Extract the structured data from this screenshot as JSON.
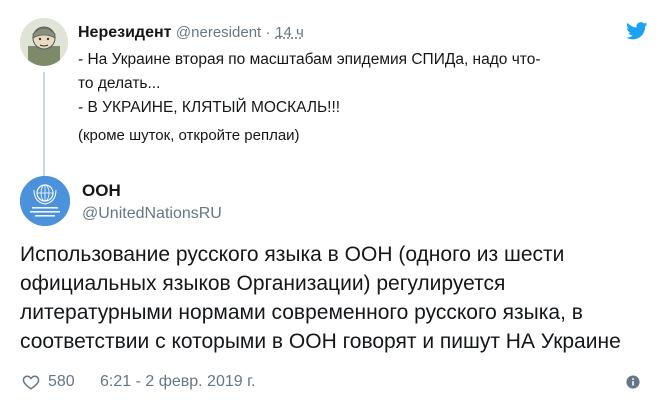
{
  "parent_tweet": {
    "name": "Нерезидент",
    "handle": "@neresident",
    "separator": "·",
    "time": "14 ч",
    "lines": [
      "- На Украине вторая по масштабам эпидемия СПИДа, надо что-",
      "то делать...",
      "- В УКРАИНЕ, КЛЯТЫЙ МОСКАЛЬ!!!",
      "(кроме шуток, откройте реплаи)"
    ]
  },
  "main_tweet": {
    "name": "ООН",
    "handle": "@UnitedNationsRU",
    "avatar_label": "Организация Объединённых Наций",
    "lines": [
      "Использование русского языка в ООН (одного из шести",
      "официальных языков Организации) регулируется",
      "литературными нормами современного русского языка, в",
      "соответствии с которыми в ООН говорят и пишут НА Украине"
    ],
    "likes": "580",
    "timestamp": "6:21 - 2 февр. 2019 г."
  },
  "icons": {
    "platform": "twitter-bird-icon",
    "like": "heart-icon",
    "info": "info-icon"
  },
  "colors": {
    "brand": "#1da1f2",
    "text": "#14171a",
    "muted": "#657786",
    "un_blue": "#4b92db"
  }
}
